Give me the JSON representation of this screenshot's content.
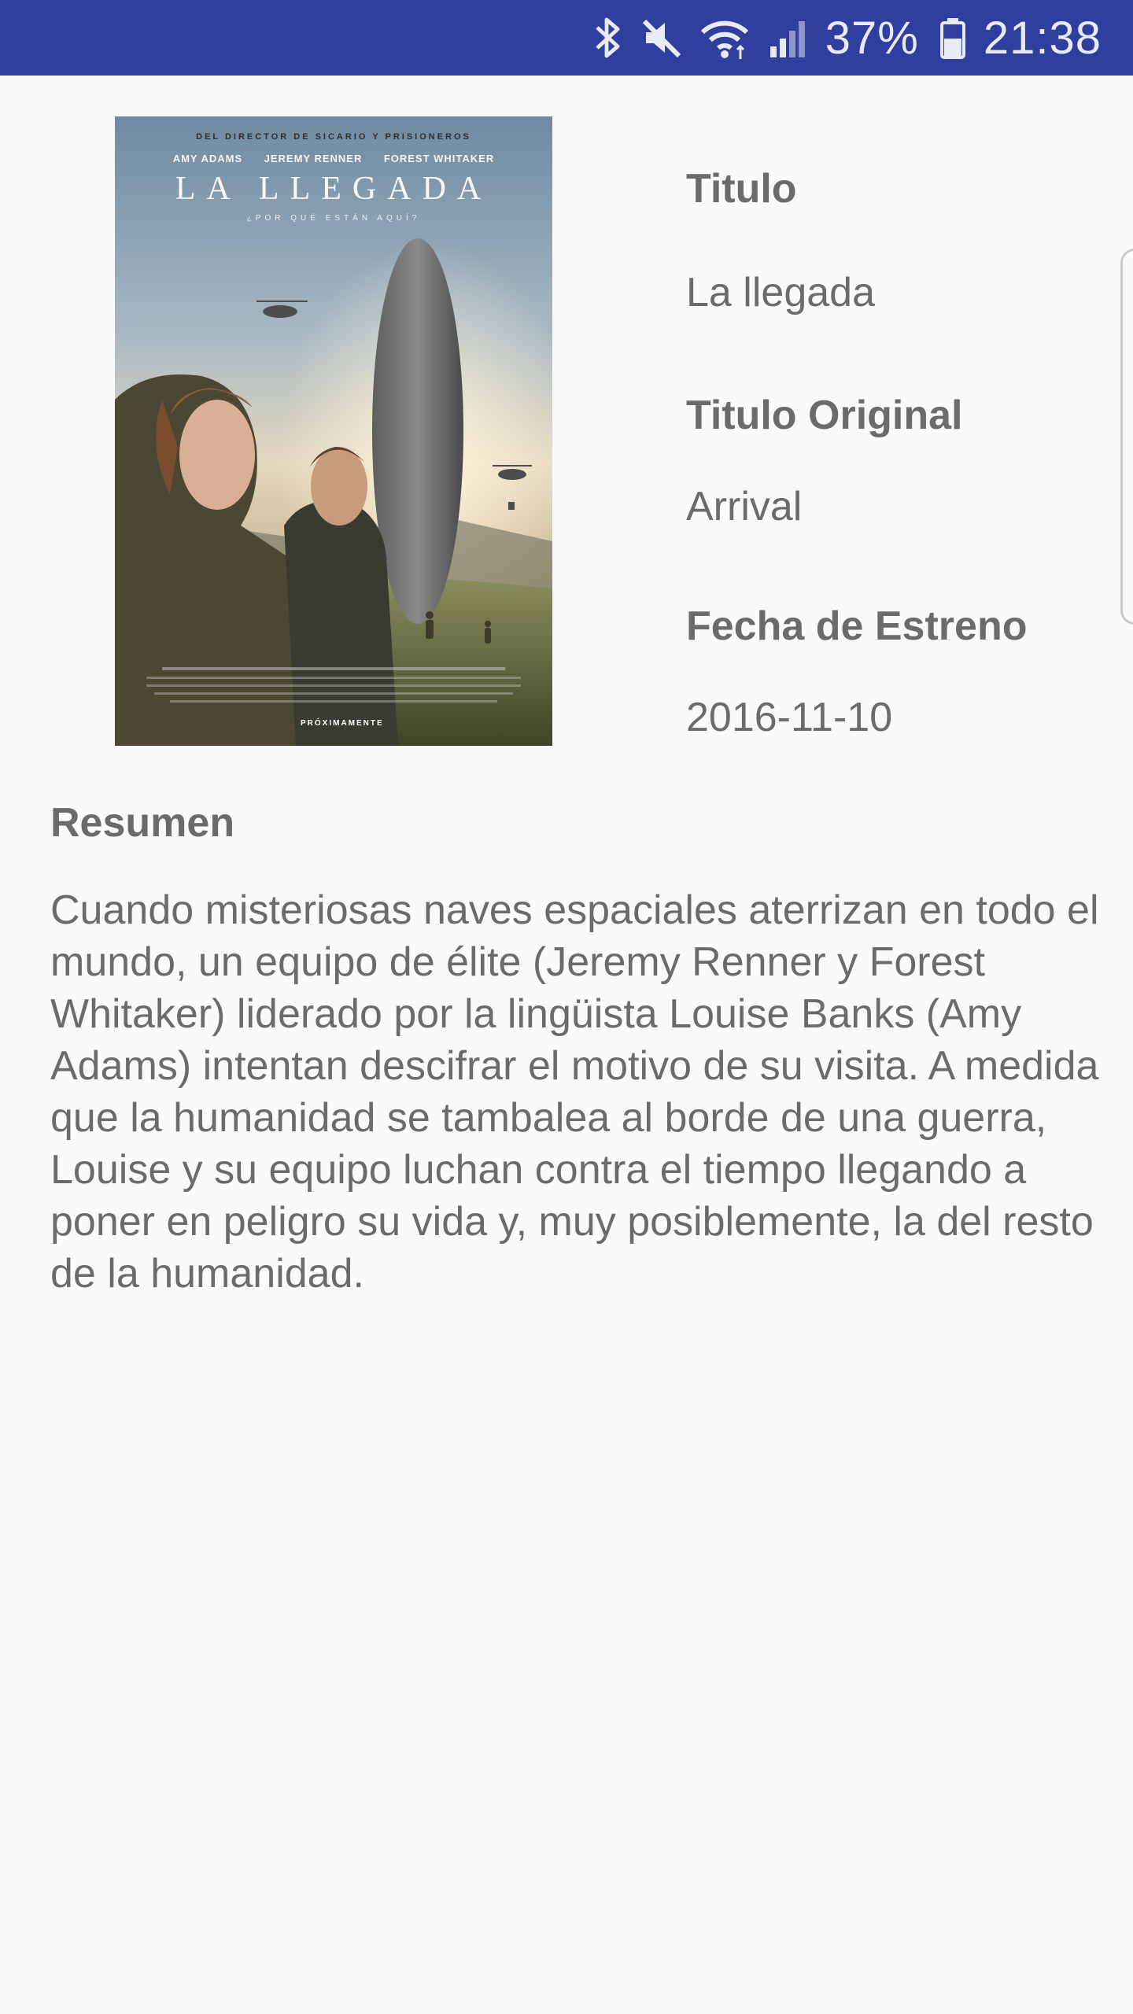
{
  "status_bar": {
    "battery_percent": "37%",
    "time": "21:38",
    "icons": [
      "bluetooth-icon",
      "mute-icon",
      "wifi-icon",
      "signal-icon",
      "battery-icon"
    ],
    "background": "#303f9f"
  },
  "poster": {
    "director_line": "DEL DIRECTOR DE SICARIO Y PRISIONEROS",
    "actors": [
      "AMY ADAMS",
      "JEREMY RENNER",
      "FOREST WHITAKER"
    ],
    "title": "LA LLEGADA",
    "tagline": "¿POR QUÉ ESTÁN AQUÍ?",
    "release_note": "PRÓXIMAMENTE"
  },
  "details": {
    "title_label": "Titulo",
    "title_value": "La llegada",
    "original_title_label": "Titulo Original",
    "original_title_value": "Arrival",
    "release_date_label": "Fecha de Estreno",
    "release_date_value": "2016-11-10"
  },
  "summary": {
    "label": "Resumen",
    "text": "Cuando misteriosas naves espaciales aterrizan en todo el mundo, un equipo de élite (Jeremy Renner y Forest Whitaker) liderado por la lingüista Louise Banks (Amy Adams) intentan descifrar el motivo de su visita. A medida que la humanidad se tambalea al borde de una guerra, Louise y su equipo luchan contra el tiempo llegando a poner en peligro su vida y, muy posiblemente, la del resto de la humanidad."
  }
}
